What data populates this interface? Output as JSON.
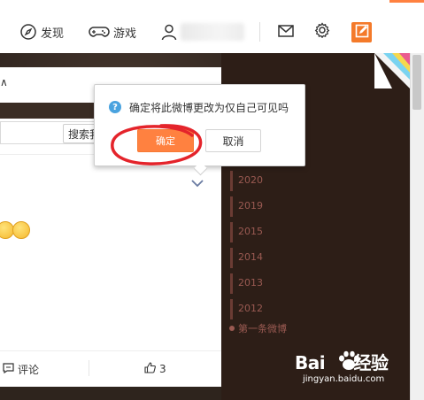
{
  "nav": {
    "discover_label": "发现",
    "games_label": "游戏"
  },
  "card": {
    "search_button_label": "搜索我",
    "comment_label": "评论",
    "like_count": "3"
  },
  "timeline": {
    "years": [
      "2020",
      "2019",
      "2015",
      "2014",
      "2013",
      "2012"
    ],
    "first_post_label": "第一条微博"
  },
  "dialog": {
    "message": "确定将此微博更改为仅自己可见吗",
    "confirm_label": "确定",
    "cancel_label": "取消"
  },
  "watermark": {
    "brand": "Bai 经验",
    "url": "jingyan.baidu.com"
  },
  "colors": {
    "accent": "#ff8140",
    "annotation_circle": "#e4242b",
    "timeline_text": "#9a5a52"
  }
}
